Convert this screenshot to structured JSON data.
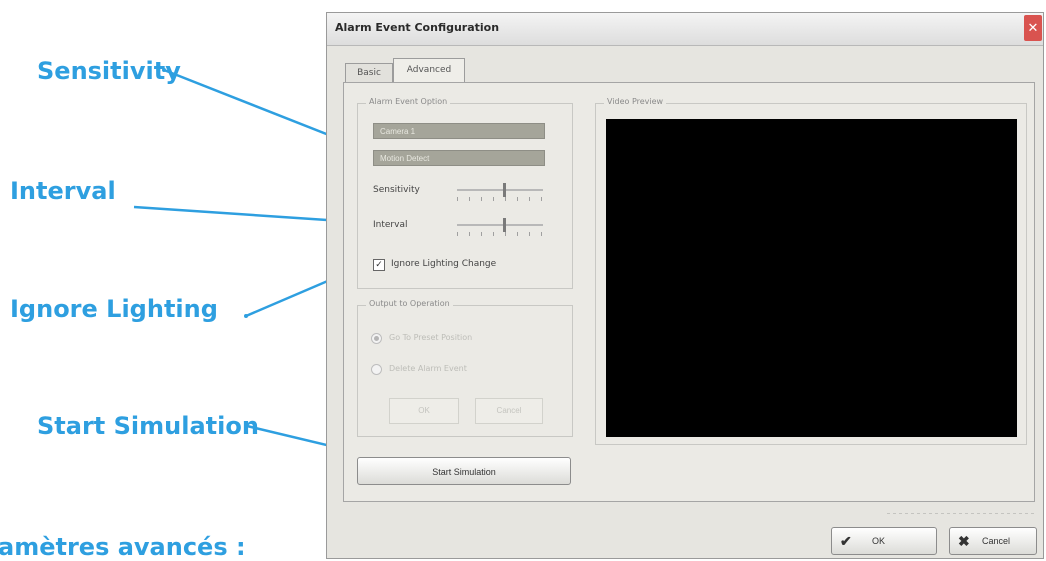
{
  "callouts": {
    "sensitivity": "Sensitivity",
    "interval": "Interval",
    "ignore_lighting": "Ignore Lighting",
    "start_simulation": "Start Simulation",
    "bottom_caption": "amètres avancés :"
  },
  "dialog": {
    "title": "Alarm Event Configuration",
    "close_icon": "close-icon",
    "tabs": [
      {
        "label": "Basic",
        "active": false
      },
      {
        "label": "Advanced",
        "active": true
      }
    ],
    "alarm_event_option": {
      "title": "Alarm Event Option",
      "camera_combo": "Camera 1",
      "mode_combo": "Motion Detect",
      "sensitivity_label": "Sensitivity",
      "sensitivity_level": 0.55,
      "interval_label": "Interval",
      "interval_level": 0.55,
      "ignore_lighting_label": "Ignore Lighting Change",
      "ignore_lighting_checked": true
    },
    "output_group": {
      "title": "Output to Operation",
      "radio1_label": "Go To Preset Position",
      "radio2_label": "Delete Alarm Event",
      "ok_label": "OK",
      "cancel_label": "Cancel"
    },
    "start_simulation_label": "Start Simulation",
    "video_preview_title": "Video Preview",
    "footer": {
      "ok_label": "OK",
      "ok_icon": "check-icon",
      "cancel_label": "Cancel",
      "cancel_icon": "x-icon"
    }
  },
  "colors": {
    "callout": "#2e9fe0",
    "preview_bg": "#000000",
    "close_button": "#d9534f"
  }
}
